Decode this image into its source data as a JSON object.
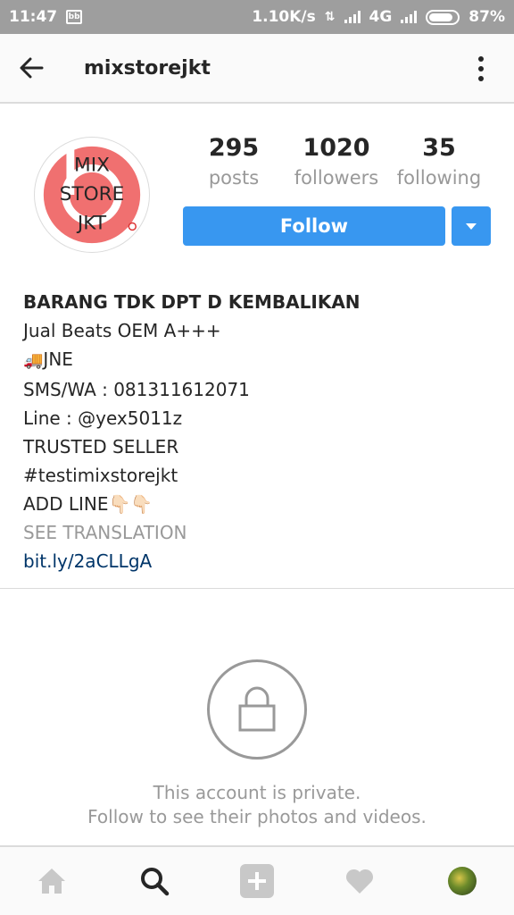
{
  "status": {
    "time": "11:47",
    "speed": "1.10K/s",
    "network": "4G",
    "battery": "87%",
    "battery_level": 0.87
  },
  "header": {
    "username": "mixstorejkt"
  },
  "avatar": {
    "line1": "MIX",
    "line2": "STORE",
    "line3": "JKT"
  },
  "stats": {
    "posts_count": "295",
    "posts_label": "posts",
    "followers_count": "1020",
    "followers_label": "followers",
    "following_count": "35",
    "following_label": "following"
  },
  "actions": {
    "follow_label": "Follow"
  },
  "bio": {
    "name": "BARANG TDK DPT D KEMBALIKAN",
    "line1": "Jual Beats OEM A+++",
    "line2_emoji": "🚚",
    "line2_text": "JNE",
    "line3": "SMS/WA : 081311612071",
    "line4": "Line : @yex5011z",
    "line5": "TRUSTED SELLER",
    "line6": "#testimixstorejkt",
    "line7": "ADD LINE👇🏻👇🏻",
    "translate": "SEE TRANSLATION",
    "link": "bit.ly/2aCLLgA"
  },
  "private": {
    "line1": "This account is private.",
    "line2": "Follow to see their photos and videos."
  },
  "colors": {
    "accent": "#3897f0",
    "link": "#003569",
    "muted": "#999999",
    "beats_red": "#f07070"
  }
}
